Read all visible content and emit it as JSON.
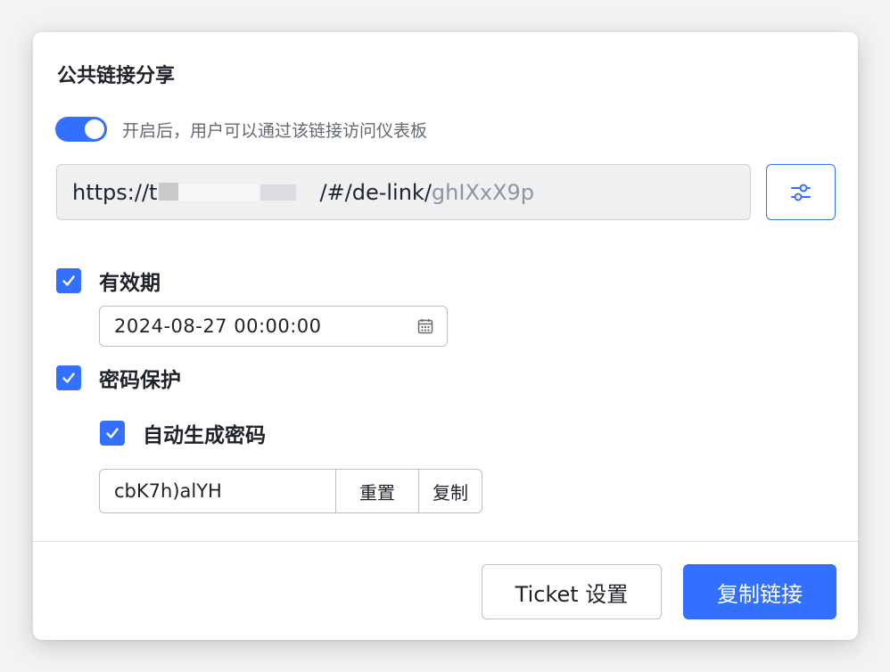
{
  "dialog": {
    "title": "公共链接分享"
  },
  "share_toggle": {
    "enabled": true,
    "label": "开启后，用户可以通过该链接访问仪表板"
  },
  "link": {
    "prefix": "https://t",
    "path": "/#/de-link/",
    "code": "ghIXxX9p"
  },
  "settings_button": {
    "icon": "sliders-icon"
  },
  "expiry": {
    "checked": true,
    "label": "有效期",
    "value": "2024-08-27 00:00:00",
    "icon": "calendar-icon"
  },
  "password_protection": {
    "checked": true,
    "label": "密码保护"
  },
  "auto_password": {
    "checked": true,
    "label": "自动生成密码"
  },
  "password": {
    "value": "cbK7h)alYH",
    "reset_label": "重置",
    "copy_label": "复制"
  },
  "footer": {
    "ticket_label": "Ticket 设置",
    "copy_link_label": "复制链接"
  },
  "colors": {
    "accent": "#3370ff",
    "text": "#1f2329",
    "muted": "#646a73",
    "code": "#8f959e"
  }
}
